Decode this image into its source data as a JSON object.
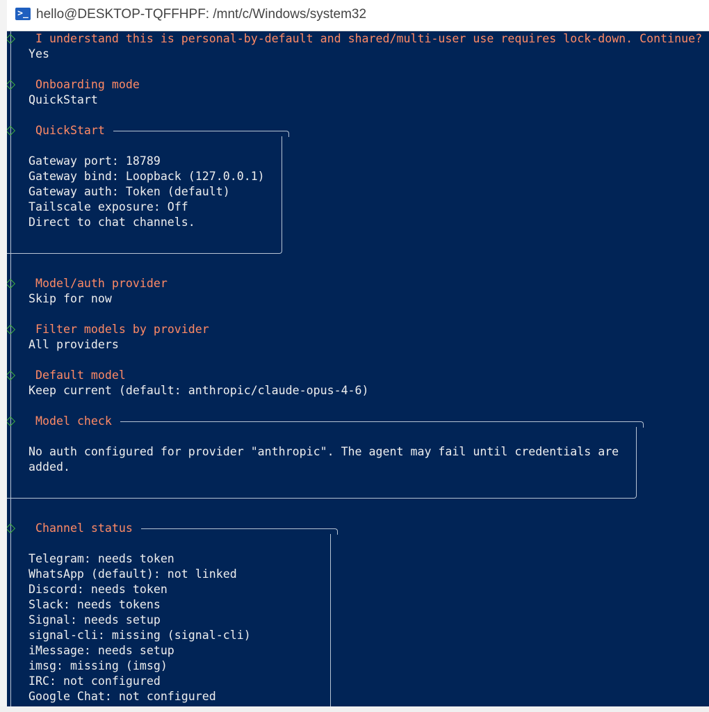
{
  "window": {
    "title": "hello@DESKTOP-TQFFHPF: /mnt/c/Windows/system32",
    "icon": "powershell-icon",
    "background": "#012456",
    "prompt_color": "#ff8a65",
    "marker_color": "#3fae3f"
  },
  "steps": [
    {
      "prompt": "I understand this is personal-by-default and shared/multi-user use requires lock-down. Continue?",
      "answer": "Yes"
    },
    {
      "prompt": "Onboarding mode",
      "answer": "QuickStart"
    },
    {
      "prompt": "Model/auth provider",
      "answer": "Skip for now"
    },
    {
      "prompt": "Filter models by provider",
      "answer": "All providers"
    },
    {
      "prompt": "Default model",
      "answer": "Keep current (default: anthropic/claude-opus-4-6)"
    }
  ],
  "boxes": {
    "quickstart": {
      "title": "QuickStart",
      "lines": [
        "Gateway port: 18789",
        "Gateway bind: Loopback (127.0.0.1)",
        "Gateway auth: Token (default)",
        "Tailscale exposure: Off",
        "Direct to chat channels."
      ]
    },
    "model_check": {
      "title": "Model check",
      "lines": [
        "No auth configured for provider \"anthropic\". The agent may fail until credentials are",
        "added."
      ]
    },
    "channel_status": {
      "title": "Channel status",
      "lines": [
        "Telegram: needs token",
        "WhatsApp (default): not linked",
        "Discord: needs token",
        "Slack: needs tokens",
        "Signal: needs setup",
        "signal-cli: missing (signal-cli)",
        "iMessage: needs setup",
        "imsg: missing (imsg)",
        "IRC: not configured",
        "Google Chat: not configured"
      ]
    }
  }
}
